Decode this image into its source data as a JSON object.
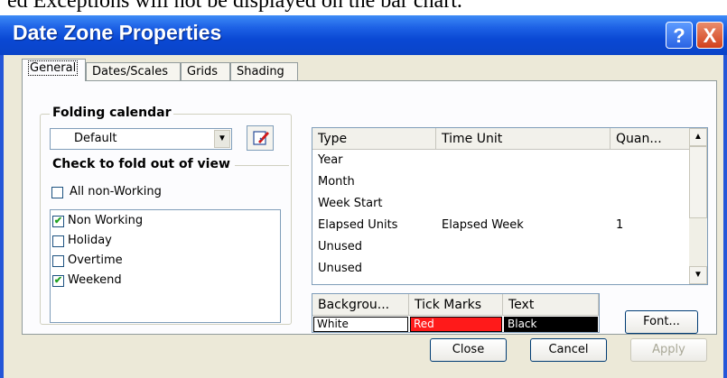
{
  "doc_fragment": "ed Exceptions will not be displayed on the bar chart.",
  "window": {
    "title": "Date Zone Properties",
    "help_glyph": "?",
    "close_glyph": "X"
  },
  "tabs": [
    {
      "label": "General"
    },
    {
      "label": "Dates/Scales"
    },
    {
      "label": "Grids"
    },
    {
      "label": "Shading"
    }
  ],
  "folding_calendar": {
    "label": "Folding calendar",
    "selected": "Default"
  },
  "fold_group": {
    "label": "Check to fold out of view",
    "all_non_working": {
      "label": "All non-Working",
      "checked": false
    }
  },
  "fold_items": [
    {
      "label": "Non Working",
      "checked": true
    },
    {
      "label": "Holiday",
      "checked": false
    },
    {
      "label": "Overtime",
      "checked": false
    },
    {
      "label": "Weekend",
      "checked": true
    }
  ],
  "zone_table": {
    "columns": [
      "Type",
      "Time Unit",
      "Quan..."
    ],
    "rows": [
      {
        "type": "Year",
        "time_unit": "",
        "quantity": ""
      },
      {
        "type": "Month",
        "time_unit": "",
        "quantity": ""
      },
      {
        "type": "Week Start",
        "time_unit": "",
        "quantity": ""
      },
      {
        "type": "Elapsed Units",
        "time_unit": "Elapsed Week",
        "quantity": "1"
      },
      {
        "type": "Unused",
        "time_unit": "",
        "quantity": ""
      },
      {
        "type": "Unused",
        "time_unit": "",
        "quantity": ""
      }
    ]
  },
  "colors_table": {
    "columns": [
      "Backgrou...",
      "Tick Marks",
      "Text"
    ],
    "values": [
      {
        "label": "White",
        "color": "#ffffff",
        "text_color": "#000000"
      },
      {
        "label": "Red",
        "color": "#ff1a1a",
        "text_color": "#ffffff"
      },
      {
        "label": "Black",
        "color": "#000000",
        "text_color": "#ffffff"
      }
    ]
  },
  "buttons": {
    "font": "Font...",
    "close": "Close",
    "cancel": "Cancel",
    "apply": "Apply"
  }
}
